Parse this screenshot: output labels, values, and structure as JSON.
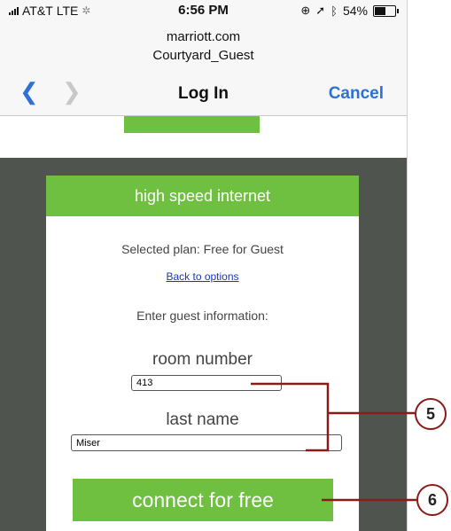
{
  "status": {
    "carrier": "AT&T",
    "network": "LTE",
    "time": "6:56 PM",
    "battery": "54%",
    "battery_level": 0.54
  },
  "browser": {
    "domain": "marriott.com",
    "ssid": "Courtyard_Guest"
  },
  "nav": {
    "back_icon": "chevron-left-icon",
    "forward_icon": "chevron-right-icon",
    "title": "Log In",
    "cancel_label": "Cancel"
  },
  "portal": {
    "header": "high speed internet",
    "selected_plan": "Selected plan: Free for Guest",
    "back_link": "Back to options",
    "instructions": "Enter guest information:",
    "room_label": "room number",
    "room_value": "413",
    "last_name_label": "last name",
    "last_name_value": "Miser",
    "connect_label": "connect for free"
  },
  "callouts": {
    "c5": "5",
    "c6": "6",
    "color": "#8b1a1a"
  },
  "colors": {
    "accent_green": "#6fc040",
    "ios_blue": "#2f6fd6",
    "dark_bg": "#4f544f"
  }
}
